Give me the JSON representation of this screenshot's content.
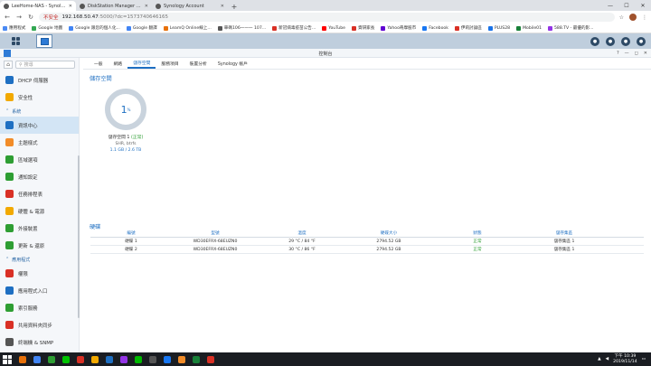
{
  "browser": {
    "tabs": [
      {
        "label": "LeeHome-NAS - Synology Di",
        "active": true
      },
      {
        "label": "DiskStation Manager - Snowis",
        "active": false
      },
      {
        "label": "Synology Account",
        "active": false
      }
    ],
    "address": {
      "warning": "不安全",
      "url": "192.168.50.47",
      "path": ":5000/?dc=1573740646165"
    },
    "bookmarks": [
      {
        "label": "應用程式",
        "color": "#4a8af4"
      },
      {
        "label": "Google 地圖",
        "color": "#34a853"
      },
      {
        "label": "Google 跟您的個人化...",
        "color": "#4285f4"
      },
      {
        "label": "Google 翻譯",
        "color": "#4285f4"
      },
      {
        "label": "LeamQ Online線上...",
        "color": "#e8710a"
      },
      {
        "label": "車碼106一一一 107...",
        "color": "#555555"
      },
      {
        "label": "新冠病毒疫苗公告...",
        "color": "#d93025"
      },
      {
        "label": "YouTube",
        "color": "#ff0000"
      },
      {
        "label": "資研家長",
        "color": "#d93025"
      },
      {
        "label": "Yahoo奇摩股市",
        "color": "#6001d2"
      },
      {
        "label": "Facebook",
        "color": "#1877f2"
      },
      {
        "label": "伊莉討論區",
        "color": "#d93025"
      },
      {
        "label": "PLUS28",
        "color": "#1a73e8"
      },
      {
        "label": "Mobile01",
        "color": "#188038"
      },
      {
        "label": "588.TV - 最優的影...",
        "color": "#9334e6"
      }
    ]
  },
  "window": {
    "title": "控制台"
  },
  "sidebar": {
    "search_placeholder": "搜尋",
    "items": [
      {
        "label": "DHCP 伺服器",
        "color": "#1e6fc2",
        "selected": false
      },
      {
        "label": "安全性",
        "color": "#f2a900",
        "selected": false
      }
    ],
    "section_system": "系統",
    "system_items": [
      {
        "label": "資訊中心",
        "color": "#1e6fc2",
        "selected": true
      },
      {
        "label": "主題樣式",
        "color": "#f28c28",
        "selected": false
      },
      {
        "label": "區域選項",
        "color": "#2e9e33",
        "selected": false
      },
      {
        "label": "通知設定",
        "color": "#2e9e33",
        "selected": false
      },
      {
        "label": "任務排程表",
        "color": "#d93025",
        "selected": false
      },
      {
        "label": "硬體 & 電源",
        "color": "#f2a900",
        "selected": false
      },
      {
        "label": "外接裝置",
        "color": "#2e9e33",
        "selected": false
      },
      {
        "label": "更新 & 還原",
        "color": "#2e9e33",
        "selected": false
      }
    ],
    "section_apps": "應用程式",
    "app_items": [
      {
        "label": "權限",
        "color": "#d93025",
        "selected": false
      },
      {
        "label": "應用程式入口",
        "color": "#1e6fc2",
        "selected": false
      },
      {
        "label": "索引服務",
        "color": "#2e9e33",
        "selected": false
      },
      {
        "label": "共用資料夾同步",
        "color": "#d93025",
        "selected": false
      },
      {
        "label": "終端機 & SNMP",
        "color": "#555555",
        "selected": false
      }
    ]
  },
  "content": {
    "tabs": [
      {
        "label": "一般",
        "active": false
      },
      {
        "label": "網路",
        "active": false
      },
      {
        "label": "儲存空間",
        "active": true
      },
      {
        "label": "服務項目",
        "active": false
      },
      {
        "label": "裝置分析",
        "active": false
      },
      {
        "label": "Synology 帳戶",
        "active": false
      }
    ],
    "storage_title": "儲存空間",
    "volume": {
      "percent": "1",
      "percent_unit": "%",
      "name": "儲存空間 1",
      "status": "(正常)",
      "fs": "SHR, btrfs",
      "usage": "1.1 GB / 2.6 TB"
    },
    "disks_title": "硬碟",
    "disk_columns": [
      "編號",
      "型號",
      "溫度",
      "硬碟大小",
      "狀態",
      "儲存集區"
    ],
    "disks": [
      {
        "id": "硬碟 1",
        "model": "WD30EFRX-68EUZN0",
        "temp": "29 °C / 84 °F",
        "size": "2794.52 GB",
        "status": "正常",
        "pool": "儲存集區 1"
      },
      {
        "id": "硬碟 2",
        "model": "WD30EFRX-68EUZN0",
        "temp": "30 °C / 86 °F",
        "size": "2794.52 GB",
        "status": "正常",
        "pool": "儲存集區 1"
      }
    ]
  },
  "taskbar": {
    "time": "下午 10:39",
    "date": "2019/11/14",
    "icons": [
      "#e8710a",
      "#4285f4",
      "#2e9e33",
      "#00c300",
      "#d93025",
      "#f2a900",
      "#1e6fc2",
      "#9334e6",
      "#00b900",
      "#555555",
      "#1877f2",
      "#f28c28",
      "#188038",
      "#d93025"
    ]
  },
  "colors": {
    "accent": "#1e6fc2",
    "ok": "#2e9e33"
  }
}
